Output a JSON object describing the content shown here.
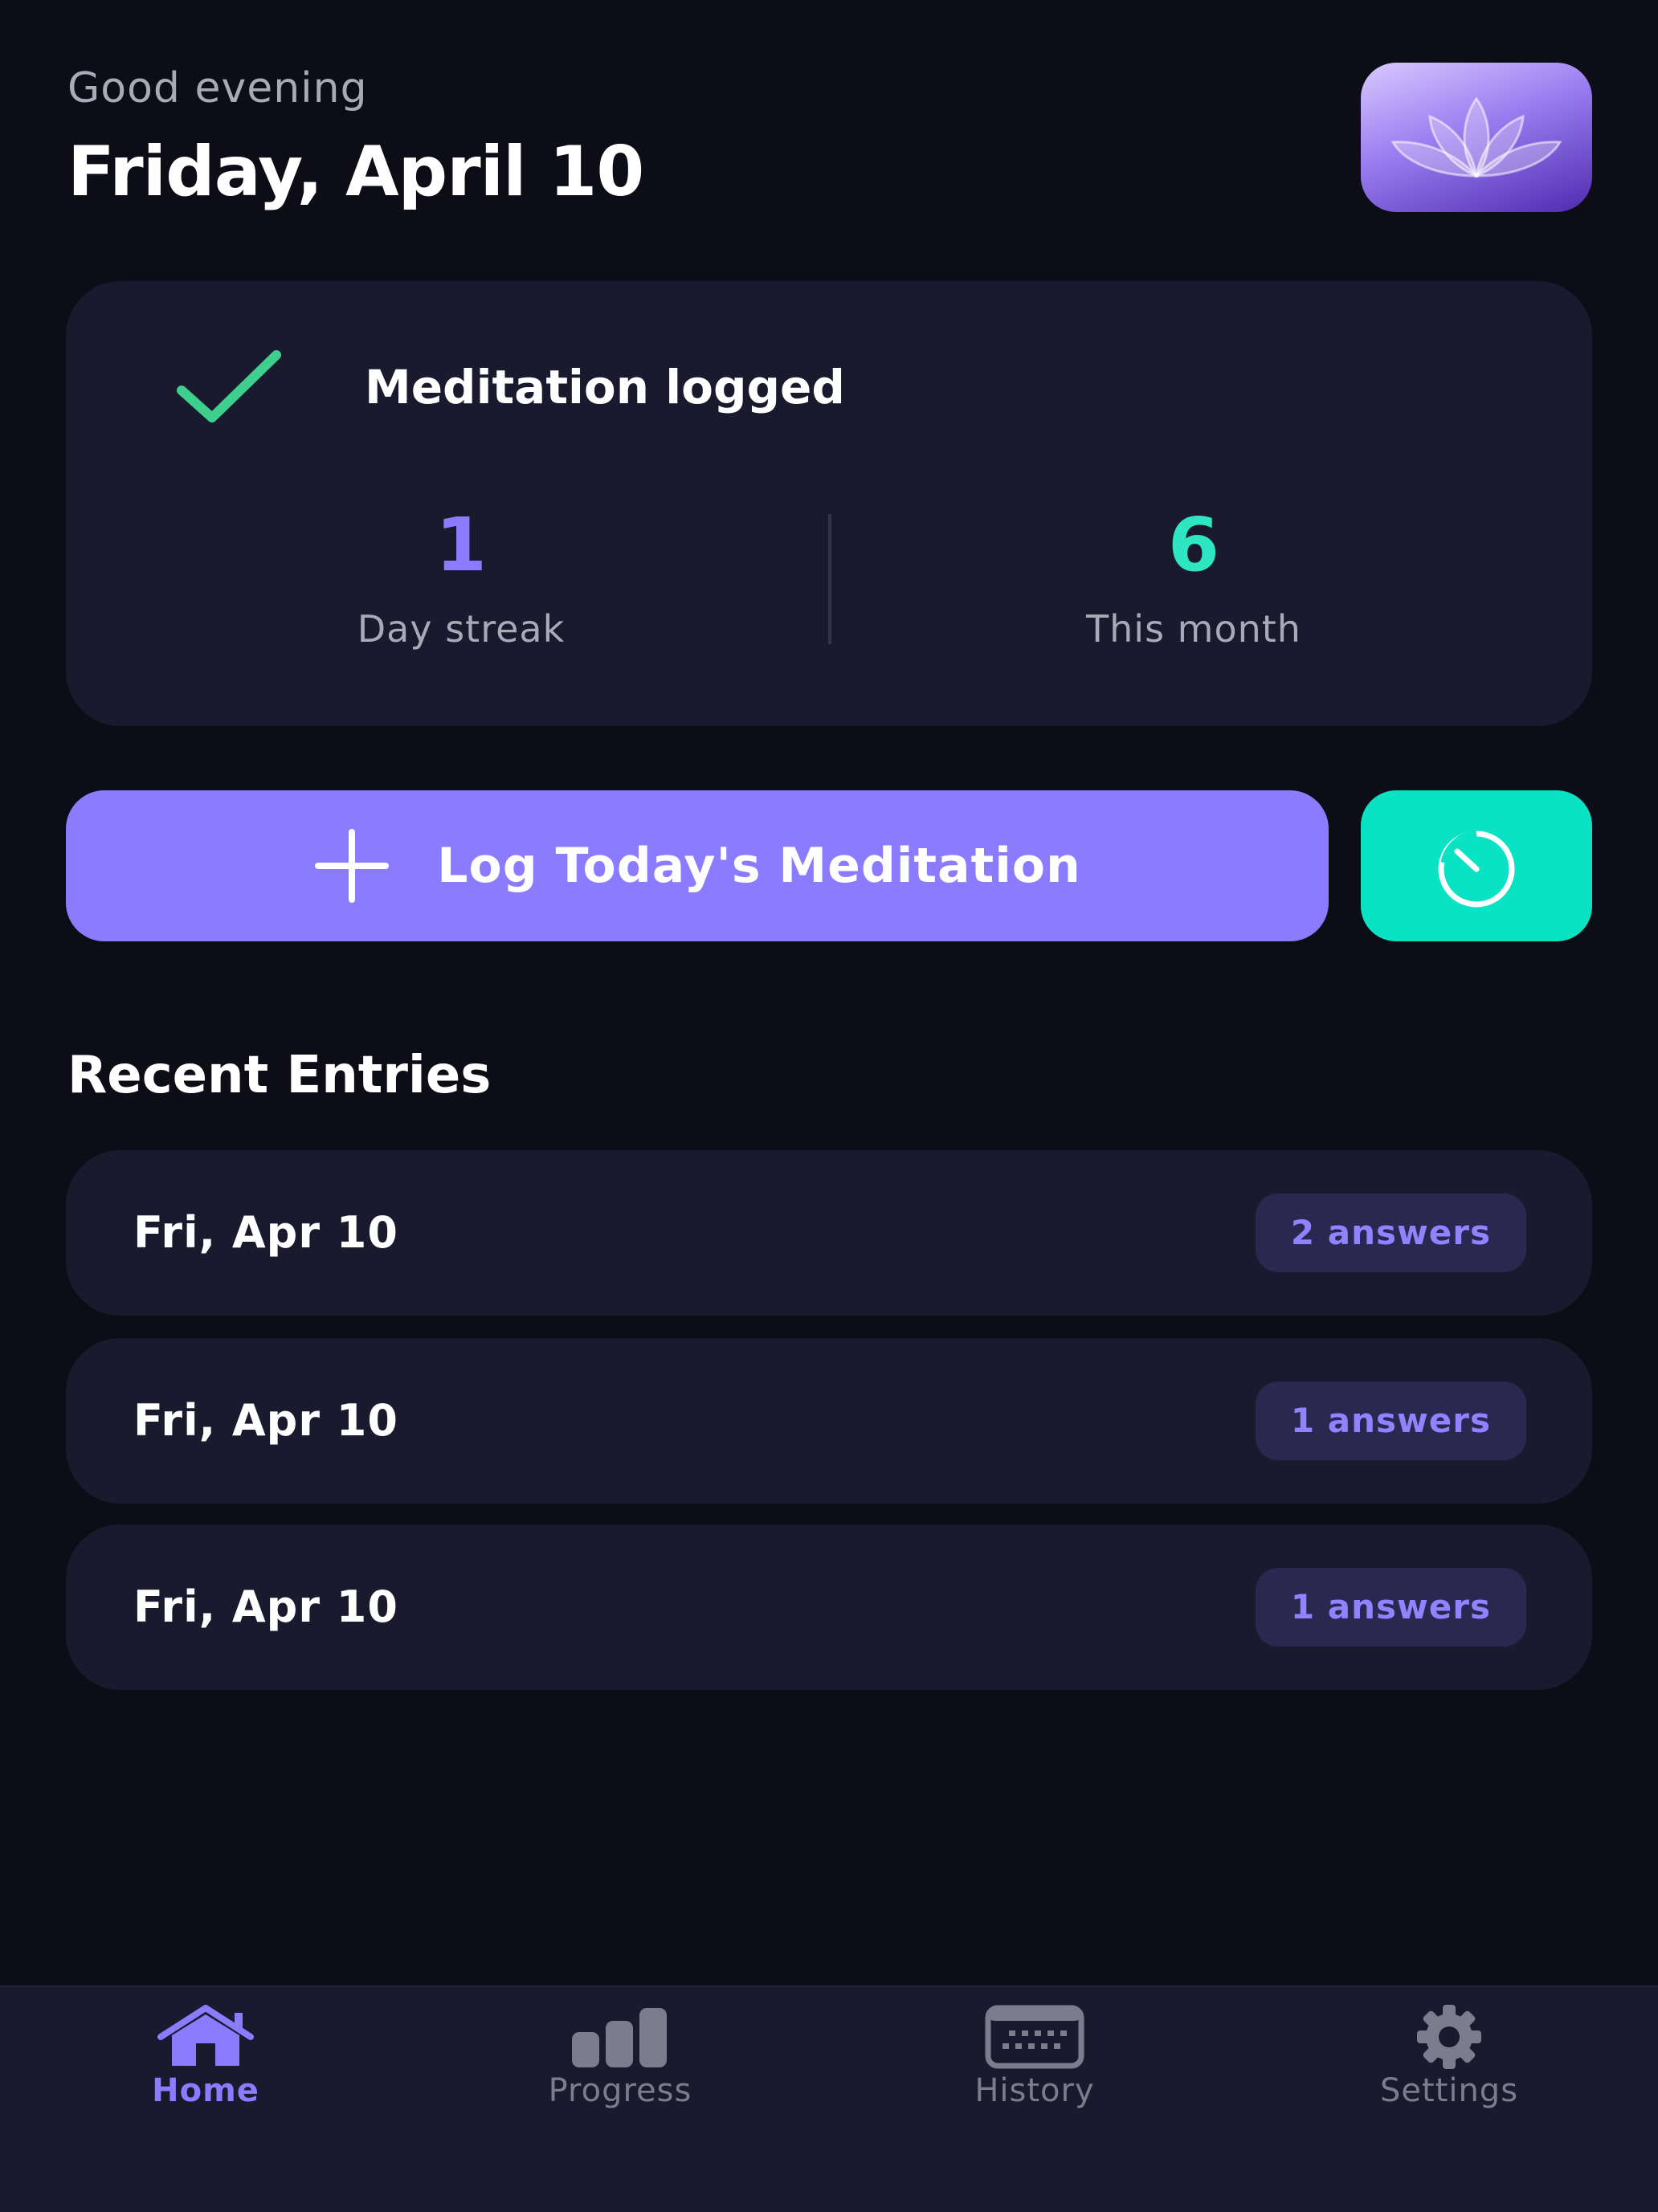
{
  "header": {
    "greeting": "Good evening",
    "date_title": "Friday, April 10",
    "app_icon": "lotus-icon"
  },
  "status_card": {
    "icon": "checkmark-icon",
    "title": "Meditation logged",
    "stats": [
      {
        "value": "1",
        "label": "Day streak",
        "color": "#8b7bff"
      },
      {
        "value": "6",
        "label": "This month",
        "color": "#2ee6c1"
      }
    ]
  },
  "actions": {
    "log_label": "Log Today's Meditation",
    "log_icon": "plus-icon",
    "timer_icon": "timer-icon"
  },
  "recent": {
    "title": "Recent Entries",
    "entries": [
      {
        "date": "Fri, Apr 10",
        "badge": "2 answers"
      },
      {
        "date": "Fri, Apr 10",
        "badge": "1 answers"
      },
      {
        "date": "Fri, Apr 10",
        "badge": "1 answers"
      }
    ]
  },
  "tabbar": {
    "tabs": [
      {
        "label": "Home",
        "icon": "home-icon",
        "active": true
      },
      {
        "label": "Progress",
        "icon": "bar-chart-icon",
        "active": false
      },
      {
        "label": "History",
        "icon": "calendar-icon",
        "active": false
      },
      {
        "label": "Settings",
        "icon": "gear-icon",
        "active": false
      }
    ]
  },
  "colors": {
    "background": "#0d0d18",
    "card": "#1a1a2e",
    "accent_purple": "#8b7bff",
    "accent_teal": "#09e3c4",
    "check_green": "#3ecf8e"
  }
}
